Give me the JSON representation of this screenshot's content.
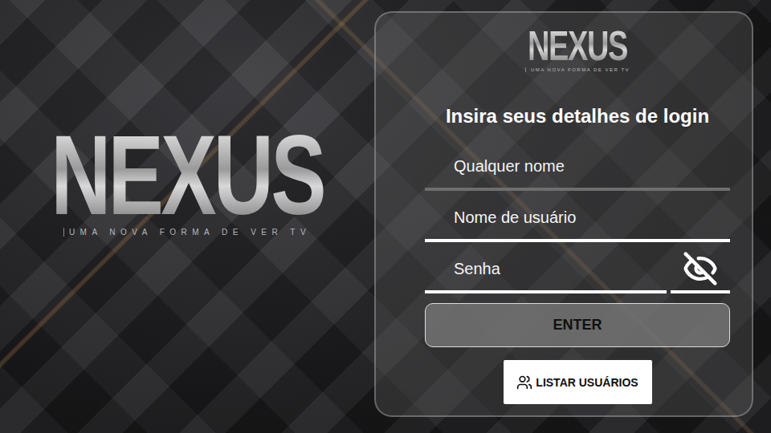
{
  "brand": {
    "logo": "NEXUS",
    "tagline": "UMA NOVA FORMA DE VER TV"
  },
  "panel": {
    "logo": "NEXUS",
    "tagline": "UMA NOVA FORMA DE VER TV",
    "heading": "Insira seus detalhes de login",
    "fields": [
      {
        "placeholder": "Qualquer nome",
        "kind": "text",
        "highlighted": false,
        "password_hidden": false
      },
      {
        "placeholder": "Nome de usuário",
        "kind": "text",
        "highlighted": true,
        "password_hidden": false
      },
      {
        "placeholder": "Senha",
        "kind": "password",
        "highlighted": true,
        "password_hidden": true
      }
    ],
    "submit": "ENTER",
    "list_users": "LISTAR USUÁRIOS"
  }
}
